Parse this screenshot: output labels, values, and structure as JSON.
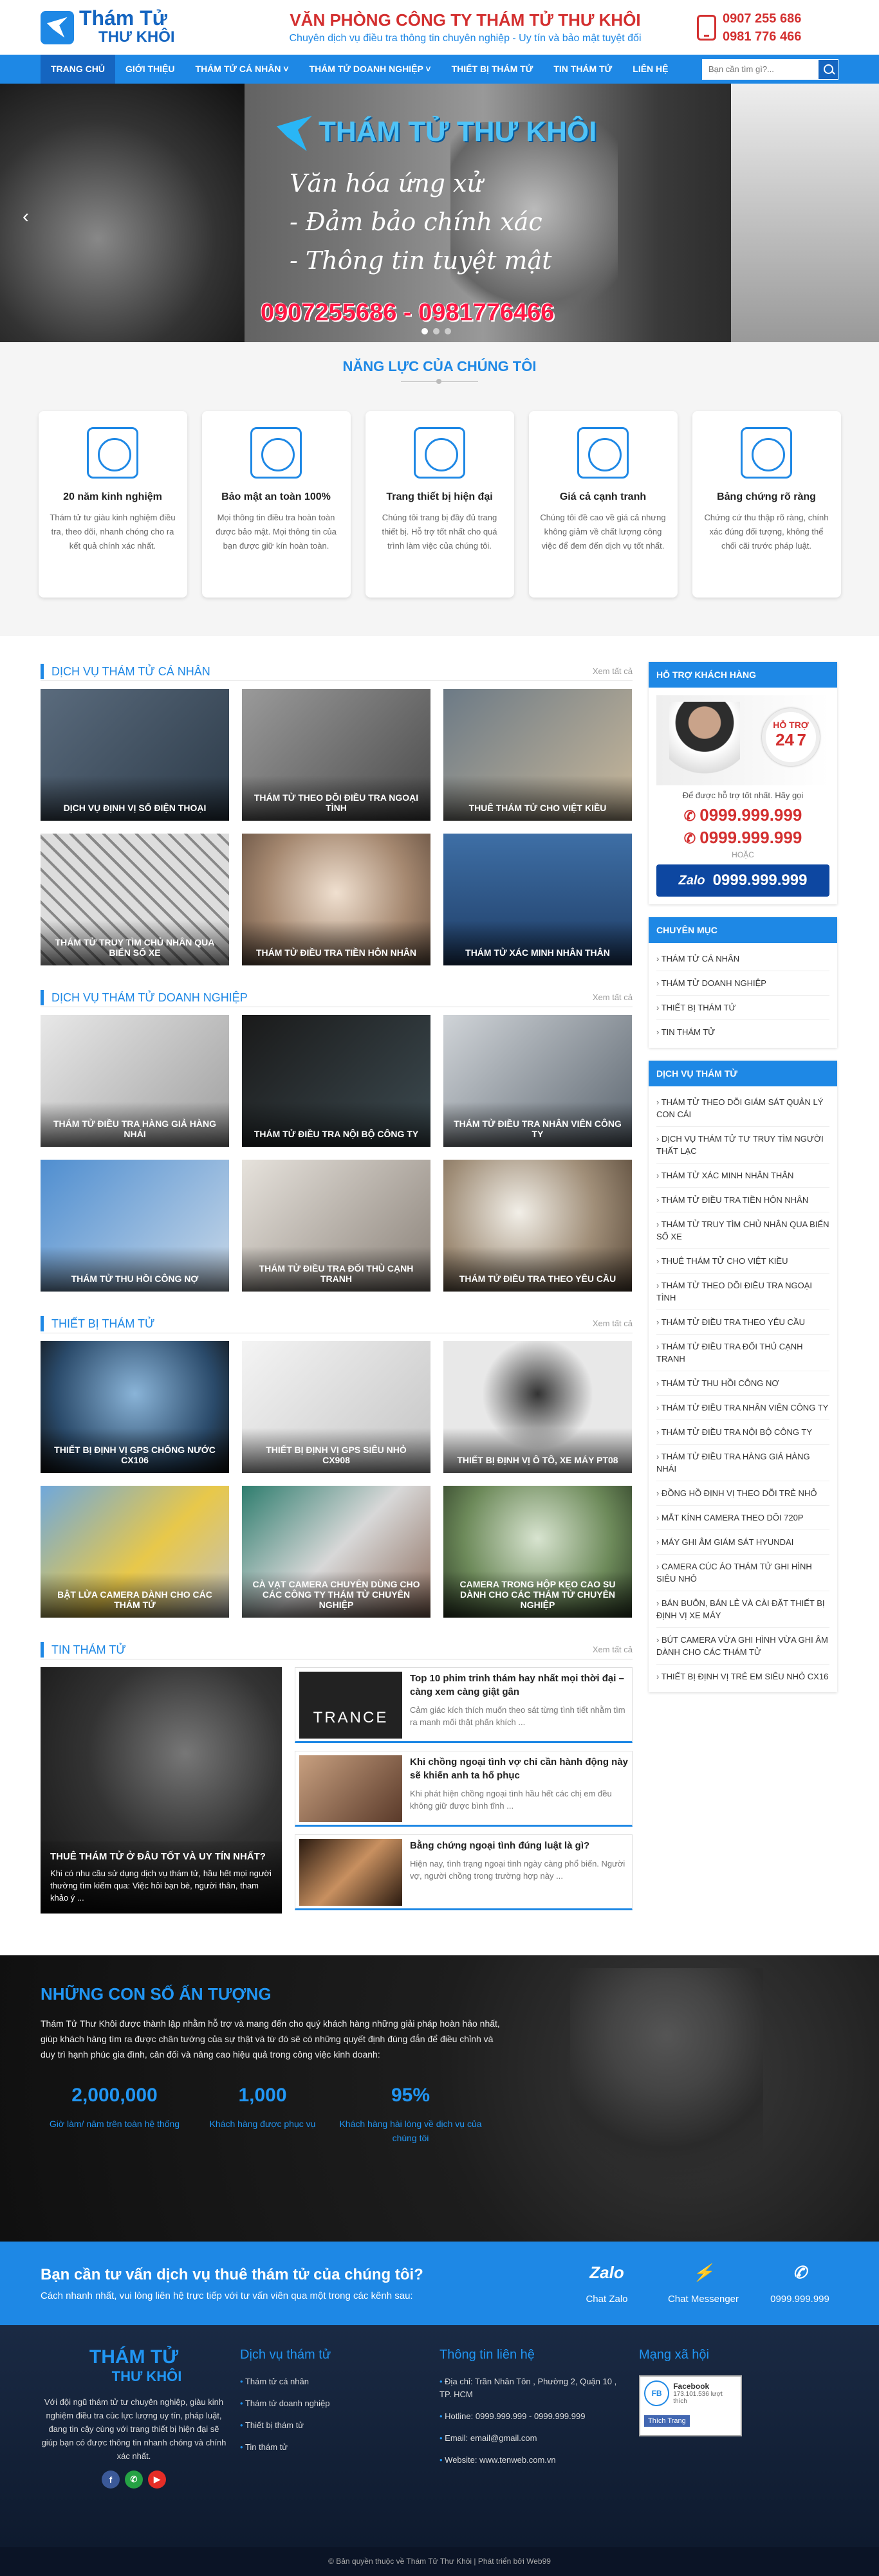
{
  "header": {
    "logo_line1": "Thám Tử",
    "logo_line2": "THƯ KHÔI",
    "company": "VĂN PHÒNG CÔNG TY THÁM TỬ THƯ KHÔI",
    "slogan": "Chuyên dịch vụ điều tra thông tin chuyên nghiệp - Uy tín và bảo mật tuyệt đối",
    "phone1": "0907 255 686",
    "phone2": "0981 776 466"
  },
  "nav": {
    "items": [
      "TRANG CHỦ",
      "GIỚI THIỆU",
      "THÁM TỬ CÁ NHÂN ˅",
      "THÁM TỬ DOANH NGHIỆP ˅",
      "THIẾT BỊ THÁM TỬ",
      "TIN THÁM TỬ",
      "LIÊN HỆ"
    ],
    "search_placeholder": "Bạn cần tìm gì?..."
  },
  "hero": {
    "title": "THÁM TỬ THƯ KHÔI",
    "line1": "Văn hóa ứng xử",
    "line2": "- Đảm bảo chính xác",
    "line3": "- Thông tin tuyệt mật",
    "phones": "0907255686 - 0981776466",
    "prev": "‹"
  },
  "capacity": {
    "title": "NĂNG LỰC CỦA CHÚNG TÔI",
    "cards": [
      {
        "title": "20 năm kinh nghiệm",
        "text": "Thám tử tư giàu kinh nghiệm điều tra, theo dõi, nhanh chóng cho ra kết quả chính xác nhất."
      },
      {
        "title": "Bảo mật an toàn 100%",
        "text": "Mọi thông tin điều tra hoàn toàn được bảo mật. Mọi thông tin của bạn được giữ kín hoàn toàn."
      },
      {
        "title": "Trang thiết bị hiện đại",
        "text": "Chúng tôi trang bị đầy đủ trang thiết bị. Hỗ trợ tốt nhất cho quá trình làm việc của chúng tôi."
      },
      {
        "title": "Giá cả cạnh tranh",
        "text": "Chúng tôi đề cao về giá cả nhưng không giảm về chất lượng công việc để đem đến dịch vụ tốt nhất."
      },
      {
        "title": "Bảng chứng rõ ràng",
        "text": "Chứng cứ thu thập rõ ràng, chính xác đúng đối tượng, không thể chối cãi trước pháp luật."
      }
    ]
  },
  "sections": {
    "more": "Xem tất cả",
    "personal": {
      "title": "DỊCH VỤ THÁM TỬ CÁ NHÂN",
      "items": [
        "DỊCH VỤ ĐỊNH VỊ SỐ ĐIỆN THOẠI",
        "THÁM TỬ THEO DÕI ĐIỀU TRA NGOẠI TÌNH",
        "THUÊ THÁM TỬ CHO VIỆT KIỀU",
        "THÁM TỬ TRUY TÌM CHỦ NHÂN QUA BIỂN SỐ XE",
        "THÁM TỬ ĐIỀU TRA TIỀN HÔN NHÂN",
        "THÁM TỬ XÁC MINH NHÂN THÂN"
      ]
    },
    "business": {
      "title": "DỊCH VỤ THÁM TỬ DOANH NGHIỆP",
      "items": [
        "THÁM TỬ ĐIỀU TRA HÀNG GIẢ HÀNG NHÁI",
        "THÁM TỬ ĐIỀU TRA NỘI BỘ CÔNG TY",
        "THÁM TỬ ĐIỀU TRA NHÂN VIÊN CÔNG TY",
        "THÁM TỬ THU HỒI CÔNG NỢ",
        "THÁM TỬ ĐIỀU TRA ĐỐI THỦ CẠNH TRANH",
        "THÁM TỬ ĐIỀU TRA THEO YÊU CẦU"
      ]
    },
    "devices": {
      "title": "THIẾT BỊ THÁM TỬ",
      "items": [
        "THIẾT BỊ ĐỊNH VỊ GPS CHỐNG NƯỚC CX106",
        "THIẾT BỊ ĐỊNH VỊ GPS SIÊU NHỎ CX908",
        "THIẾT BỊ ĐỊNH VỊ Ô TÔ, XE MÁY PT08",
        "BẬT LỬA CAMERA DÀNH CHO CÁC THÁM TỬ",
        "CÀ VẠT CAMERA CHUYÊN DÙNG CHO CÁC CÔNG TY THÁM TỬ CHUYÊN NGHIỆP",
        "CAMERA TRONG HỘP KẸO CAO SU DÀNH CHO CÁC THÁM TỬ CHUYÊN NGHIỆP"
      ]
    },
    "news": {
      "title": "TIN THÁM TỬ",
      "big": {
        "title": "THUÊ THÁM TỬ Ở ĐÂU TỐT VÀ UY TÍN NHẤT?",
        "text": "Khi có nhu cầu sử dụng dịch vụ thám tử, hầu hết mọi người thường tìm kiếm qua: Việc hỏi bạn bè, người thân, tham khảo ý ..."
      },
      "items": [
        {
          "title": "Top 10 phim trinh thám hay nhất mọi thời đại – càng xem càng giật gân",
          "text": "Cảm giác kích thích muốn theo sát từng tình tiết nhằm tìm ra manh mối thật phấn khích ...",
          "thumb": "TRANCE"
        },
        {
          "title": "Khi chồng ngoại tình vợ chỉ cần hành động này sẽ khiến anh ta hổ phục",
          "text": "Khi phát hiện chồng ngoại tình hầu hết các chị em đều không giữ được bình tĩnh ...",
          "thumb": ""
        },
        {
          "title": "Bằng chứng ngoại tình đúng luật là gì?",
          "text": "Hiện nay, tình trạng ngoại tình ngày càng phổ biến. Người vợ, người chồng trong trường hợp này ...",
          "thumb": ""
        }
      ]
    }
  },
  "sidebar": {
    "support_title": "HỖ TRỢ KHÁCH HÀNG",
    "badge_top": "HỖ TRỢ",
    "badge_num": "24",
    "badge_num2": "7",
    "note": "Để được hỗ trợ tốt nhất. Hãy gọi",
    "phone1": "0999.999.999",
    "phone2": "0999.999.999",
    "or": "HOẶC",
    "zalo_label": "Zalo",
    "zalo_phone": "0999.999.999",
    "cat_title": "CHUYÊN MỤC",
    "categories": [
      "THÁM TỬ CÁ NHÂN",
      "THÁM TỬ DOANH NGHIỆP",
      "THIẾT BỊ THÁM TỬ",
      "TIN THÁM TỬ"
    ],
    "svc_title": "DỊCH VỤ THÁM TỬ",
    "services": [
      "THÁM TỬ THEO DÕI GIÁM SÁT QUẢN LÝ CON CÁI",
      "DỊCH VỤ THÁM TỬ TƯ TRUY TÌM NGƯỜI THẤT LẠC",
      "THÁM TỬ XÁC MINH NHÂN THÂN",
      "THÁM TỬ ĐIỀU TRA TIỀN HÔN NHÂN",
      "THÁM TỬ TRUY TÌM CHỦ NHÂN QUA BIỂN SỐ XE",
      "THUÊ THÁM TỬ CHO VIỆT KIỀU",
      "THÁM TỬ THEO DÕI ĐIỀU TRA NGOẠI TÌNH",
      "THÁM TỬ ĐIỀU TRA THEO YÊU CẦU",
      "THÁM TỬ ĐIỀU TRA ĐỐI THỦ CẠNH TRANH",
      "THÁM TỬ THU HỒI CÔNG NỢ",
      "THÁM TỬ ĐIỀU TRA NHÂN VIÊN CÔNG TY",
      "THÁM TỬ ĐIỀU TRA NỘI BỘ CÔNG TY",
      "THÁM TỬ ĐIỀU TRA HÀNG GIẢ HÀNG NHÁI",
      "ĐỒNG HỒ ĐỊNH VỊ THEO DÕI TRẺ NHỎ",
      "MẮT KÍNH CAMERA THEO DÕI 720P",
      "MÁY GHI ÂM GIÁM SÁT HYUNDAI",
      "CAMERA CÚC ÁO THÁM TỬ GHI HÌNH SIÊU NHỎ",
      "BÁN BUÔN, BÁN LẺ VÀ CÀI ĐẶT THIẾT BỊ ĐỊNH VỊ XE MÁY",
      "BÚT CAMERA VỪA GHI HÌNH VỪA GHI ÂM DÀNH CHO CÁC THÁM TỬ",
      "THIẾT BỊ ĐỊNH VỊ TRẺ EM SIÊU NHỎ CX16"
    ]
  },
  "stats": {
    "title": "NHỮNG CON SỐ ẤN TƯỢNG",
    "text": "Thám Tử Thư Khôi được thành lập nhằm hỗ trợ và mang đến cho quý khách hàng những giải pháp hoàn hảo nhất, giúp khách hàng tìm ra được chân tướng của sự thật và từ đó sẽ có những quyết định đúng đắn để điều chỉnh và duy trì hạnh phúc gia đình, cân đối và nâng cao hiệu quả trong công việc kinh doanh:",
    "items": [
      {
        "value": "2,000,000",
        "label": "Giờ làm/ năm trên toàn hệ thống"
      },
      {
        "value": "1,000",
        "label": "Khách hàng được phục vụ"
      },
      {
        "value": "95%",
        "label": "Khách hàng hài lòng về dịch vụ của chúng tôi"
      }
    ]
  },
  "cta": {
    "title": "Bạn cần tư vấn dịch vụ thuê thám tử của chúng tôi?",
    "text": "Cách nhanh nhất, vui lòng liên hệ trực tiếp với tư vấn viên qua một trong các kênh sau:",
    "zalo_icon": "Zalo",
    "actions": [
      "Chat Zalo",
      "Chat Messenger",
      "0999.999.999"
    ]
  },
  "footer": {
    "logo1": "THÁM TỬ",
    "logo2": "THƯ KHÔI",
    "about": "Với đội ngũ thám tử tư chuyên nghiệp, giàu kinh nghiệm điều tra cùc lực lượng uy tín, pháp luật, đang tin cậy cùng với trang thiết bị hiện đại sẽ giúp bạn có được thông tin nhanh chóng và chính xác nhất.",
    "social": [
      "f",
      "✆",
      "▶"
    ],
    "svc_title": "Dịch vụ thám tử",
    "services": [
      "Thám tử cá nhân",
      "Thám tử doanh nghiệp",
      "Thiết bị thám tử",
      "Tin thám tử"
    ],
    "contact_title": "Thông tin liên hệ",
    "contacts": [
      "Địa chỉ: Trần Nhân Tôn , Phường 2, Quận 10 , TP. HCM",
      "Hotline: 0999.999.999 - 0999.999.999",
      "Email: email@gmail.com",
      "Website: www.tenweb.com.vn"
    ],
    "social_title": "Mạng xã hội",
    "fb_name": "Facebook",
    "fb_likes": "173.101.536 lượt thích",
    "fb_like_btn": "Thích Trang",
    "copyright": "© Bản quyền thuộc về Thám Tử Thư Khôi  |  Phát triển bởi Web99"
  }
}
